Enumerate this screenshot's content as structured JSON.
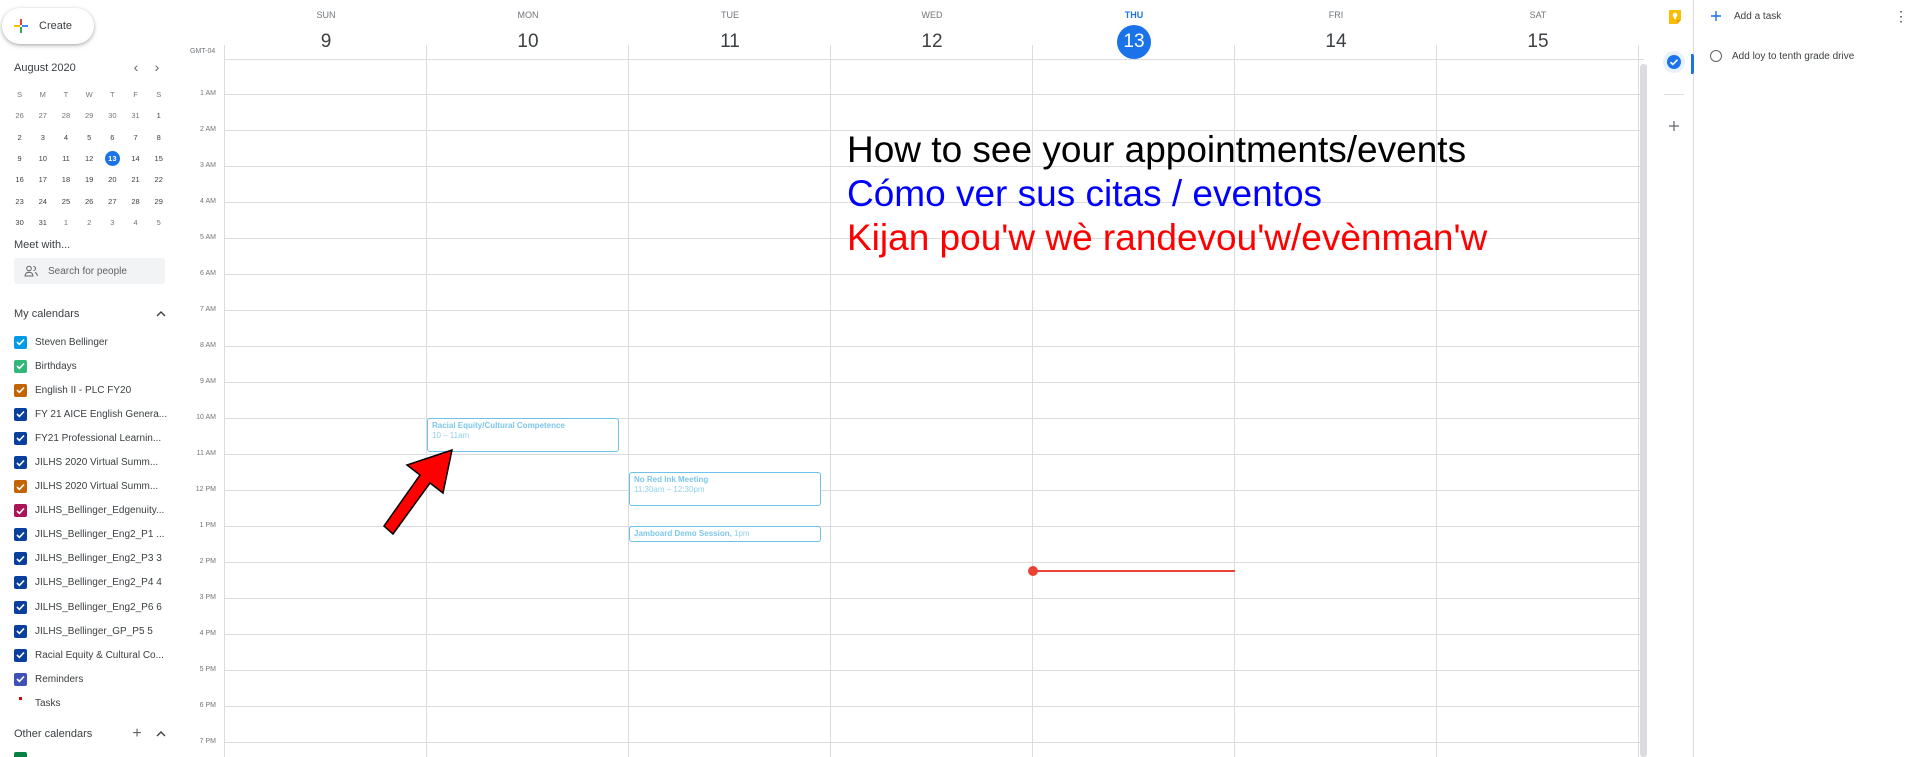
{
  "create_label": "Create",
  "mini_calendar": {
    "title": "August 2020",
    "prev_icon": "‹",
    "next_icon": "›",
    "weekdays": [
      "S",
      "M",
      "T",
      "W",
      "T",
      "F",
      "S"
    ],
    "weeks": [
      [
        "26",
        "27",
        "28",
        "29",
        "30",
        "31",
        "1"
      ],
      [
        "2",
        "3",
        "4",
        "5",
        "6",
        "7",
        "8"
      ],
      [
        "9",
        "10",
        "11",
        "12",
        "13",
        "14",
        "15"
      ],
      [
        "16",
        "17",
        "18",
        "19",
        "20",
        "21",
        "22"
      ],
      [
        "23",
        "24",
        "25",
        "26",
        "27",
        "28",
        "29"
      ],
      [
        "30",
        "31",
        "1",
        "2",
        "3",
        "4",
        "5"
      ]
    ],
    "today": "13"
  },
  "meet": {
    "title": "Meet with...",
    "search_placeholder": "Search for people"
  },
  "my_calendars": {
    "title": "My calendars",
    "items": [
      {
        "label": "Steven Bellinger",
        "color": "#039be5"
      },
      {
        "label": "Birthdays",
        "color": "#33b679"
      },
      {
        "label": "English II - PLC FY20",
        "color": "#c26401"
      },
      {
        "label": "FY 21 AICE English Genera...",
        "color": "#0b3f9d"
      },
      {
        "label": "FY21 Professional Learnin...",
        "color": "#0b3f9d"
      },
      {
        "label": "JILHS 2020 Virtual Summ...",
        "color": "#0b3f9d"
      },
      {
        "label": "JILHS 2020 Virtual Summ...",
        "color": "#c26401"
      },
      {
        "label": "JILHS_Bellinger_Edgenuity...",
        "color": "#ad1457"
      },
      {
        "label": "JILHS_Bellinger_Eng2_P1 ...",
        "color": "#0b3f9d"
      },
      {
        "label": "JILHS_Bellinger_Eng2_P3 3",
        "color": "#0b3f9d"
      },
      {
        "label": "JILHS_Bellinger_Eng2_P4 4",
        "color": "#0b3f9d"
      },
      {
        "label": "JILHS_Bellinger_Eng2_P6 6",
        "color": "#0b3f9d"
      },
      {
        "label": "JILHS_Bellinger_GP_P5 5",
        "color": "#0b3f9d"
      },
      {
        "label": "Racial Equity & Cultural Co...",
        "color": "#0b3f9d"
      },
      {
        "label": "Reminders",
        "color": "#3f51b5"
      },
      {
        "label": "Tasks",
        "color": "#d50000"
      }
    ]
  },
  "other_calendars": {
    "title": "Other calendars",
    "add_icon": "+"
  },
  "week": {
    "days": [
      {
        "dow": "SUN",
        "num": "9"
      },
      {
        "dow": "MON",
        "num": "10"
      },
      {
        "dow": "TUE",
        "num": "11"
      },
      {
        "dow": "WED",
        "num": "12"
      },
      {
        "dow": "THU",
        "num": "13",
        "today": true
      },
      {
        "dow": "FRI",
        "num": "14"
      },
      {
        "dow": "SAT",
        "num": "15"
      }
    ],
    "timezone": "GMT-04",
    "hours": [
      "1 AM",
      "2 AM",
      "3 AM",
      "4 AM",
      "5 AM",
      "6 AM",
      "7 AM",
      "8 AM",
      "9 AM",
      "10 AM",
      "11 AM",
      "12 PM",
      "1 PM",
      "2 PM",
      "3 PM",
      "4 PM",
      "5 PM",
      "6 PM",
      "7 PM"
    ],
    "now_hours": 14.25
  },
  "events": [
    {
      "title": "Racial Equity/Cultural Competence",
      "time": "10 – 11am",
      "day": 1,
      "start": 10.0,
      "end": 11.0
    },
    {
      "title": "No Red Ink Meeting",
      "time": "11:30am – 12:30pm",
      "day": 2,
      "start": 11.5,
      "end": 12.5
    },
    {
      "title": "Jamboard Demo Session,",
      "time": " 1pm",
      "day": 2,
      "start": 13.0,
      "end": 13.5,
      "inline": true
    }
  ],
  "overlay": {
    "line1": "How to see your appointments/events",
    "line2": "Cómo ver sus citas / eventos",
    "line3": "Kijan pou'w wè randevou'w/evènman'w",
    "color1": "#000000",
    "color2": "#0000ff",
    "color3": "#ff0000"
  },
  "arrow_color": "#ff0000",
  "tasks": {
    "add_label": "Add a task",
    "item_label": "Add loy to tenth grade drive",
    "more_icon": "⋮"
  }
}
